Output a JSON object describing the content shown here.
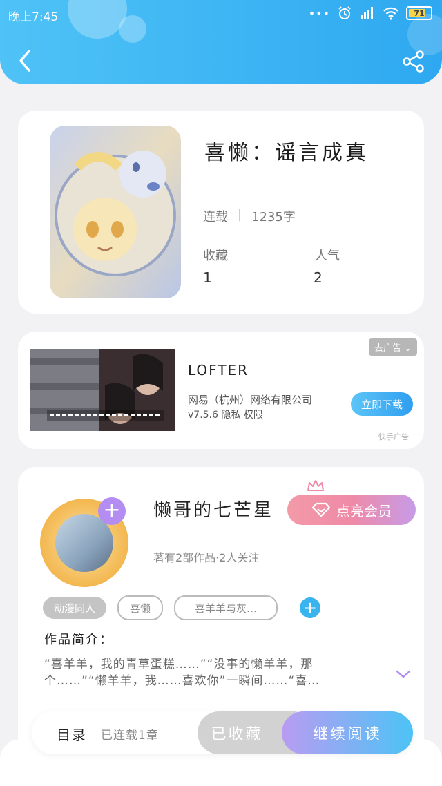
{
  "status_bar": {
    "time": "晚上7:45",
    "battery": "71"
  },
  "book": {
    "title": "喜懒：谣言成真",
    "status": "连载",
    "word_count": "1235字",
    "favorites_label": "收藏",
    "favorites_value": "1",
    "popularity_label": "人气",
    "popularity_value": "2"
  },
  "ad": {
    "tag": "去广告",
    "app_name": "LOFTER",
    "company": "网易（杭州）网络有限公司",
    "version_info": "v7.5.6 隐私 权限",
    "download_label": "立即下载",
    "source": "快手广告"
  },
  "author": {
    "name": "懒哥的七芒星",
    "vip_label": "点亮会员",
    "meta": "著有2部作品·2人关注",
    "tags": [
      "动漫同人",
      "喜懒",
      "喜羊羊与灰…"
    ],
    "intro_label": "作品简介：",
    "intro_text": "“喜羊羊，我的青草蛋糕……”“没事的懒羊羊，那个……”“懒羊羊，我……喜欢你”一瞬间……“喜…"
  },
  "bottom_bar": {
    "toc_label": "目录",
    "toc_status": "已连载1章",
    "collected_label": "已收藏",
    "read_label": "继续阅读"
  },
  "colors": {
    "header": "#2ea8f0",
    "accent": "#3ab4ef",
    "vip": "#ef8aa7",
    "read_gradient_start": "#b99cf1",
    "read_gradient_end": "#4cc3f6"
  },
  "icons": [
    "back-arrow-icon",
    "share-icon",
    "alarm-icon",
    "signal-icon",
    "wifi-icon",
    "battery-icon",
    "plus-icon",
    "crown-icon",
    "diamond-icon",
    "chevron-down-icon"
  ]
}
